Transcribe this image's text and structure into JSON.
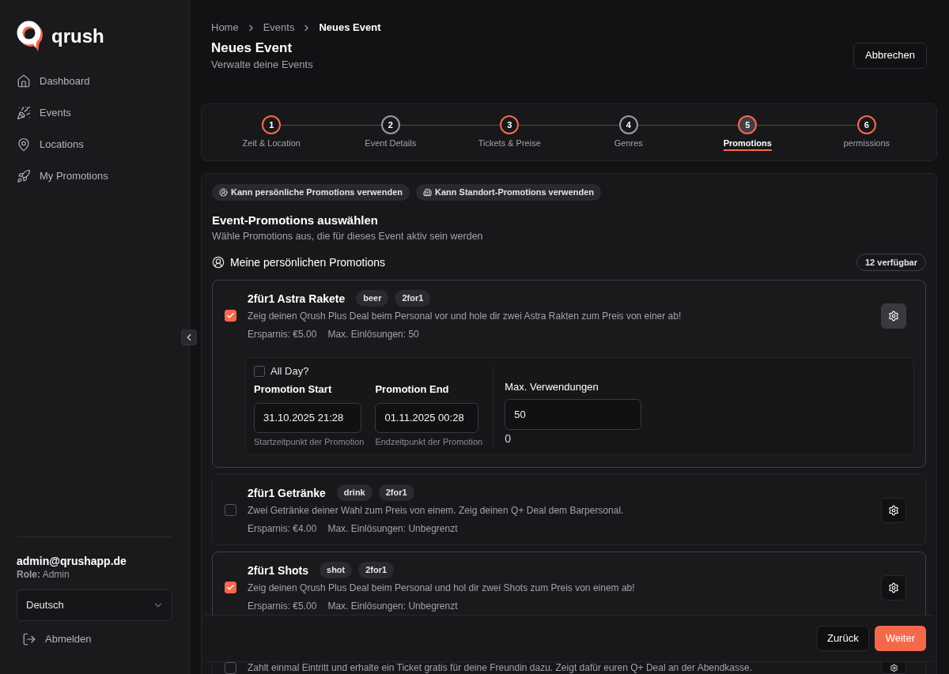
{
  "sidebar": {
    "logo": "qrush",
    "nav": [
      {
        "label": "Dashboard"
      },
      {
        "label": "Events"
      },
      {
        "label": "Locations"
      },
      {
        "label": "My Promotions"
      }
    ],
    "user": {
      "email": "admin@qrushapp.de",
      "role": "**Role:** Admin"
    },
    "language": "Deutsch",
    "logout": "Abmelden"
  },
  "breadcrumb": [
    {
      "label": "Home",
      "current": false
    },
    {
      "label": "Events",
      "current": false
    },
    {
      "label": "Neues Event",
      "current": true
    }
  ],
  "header": {
    "title": "Neues Event",
    "subtitle": "Verwalte deine Events",
    "cancel_button": "Abbrechen"
  },
  "stepper": {
    "steps": [
      {
        "number": "1",
        "label": "Zeit & Location",
        "complete": true,
        "selected": false
      },
      {
        "number": "2",
        "label": "Event Details",
        "complete": false,
        "selected": false
      },
      {
        "number": "3",
        "label": "Tickets & Preise",
        "complete": true,
        "selected": false
      },
      {
        "number": "4",
        "label": "Genres",
        "complete": false,
        "selected": false
      },
      {
        "number": "5",
        "label": "Promotions",
        "complete": true,
        "selected": true
      },
      {
        "number": "6",
        "label": "permissions",
        "complete": true,
        "selected": false
      }
    ]
  },
  "promotions": {
    "badges": [
      "Kann persönliche Promotions verwenden",
      "Kann Standort-Promotions verwenden"
    ],
    "title": "Event-Promotions auswählen",
    "subtitle": "Wähle Promotions aus, die für dieses Event aktiv sein werden",
    "section": {
      "title": "Meine persönlichen Promotions",
      "count": "12 verfügbar"
    },
    "items": [
      {
        "title": "2für1 Astra Rakete",
        "tags": [
          "beer",
          "2for1"
        ],
        "description": "Zeig deinen Qrush Plus Deal beim Personal vor und hole dir zwei Astra Rakten zum Preis von einer ab!",
        "savings": "Ersparnis: €5.00",
        "max": "Max. Einlösungen: 50",
        "checked": true,
        "expanded": true,
        "settings": {
          "all_day": {
            "label": "All Day?",
            "checked": false
          },
          "start": {
            "label": "Promotion Start",
            "value": "31.10.2025 21:28",
            "hint": "Startzeitpunkt der Promotion"
          },
          "end": {
            "label": "Promotion End",
            "value": "01.11.2025 00:28",
            "hint": "Endzeitpunkt der Promotion"
          },
          "max_uses": {
            "label": "Max. Verwendungen",
            "value": "50",
            "note": "0"
          }
        }
      },
      {
        "title": "2für1 Getränke",
        "tags": [
          "drink",
          "2for1"
        ],
        "description": "Zwei Getränke deiner Wahl zum Preis von einem. Zeig deinen Q+ Deal dem Barpersonal.",
        "savings": "Ersparnis: €4.00",
        "max": "Max. Einlösungen: Unbegrenzt",
        "checked": false,
        "expanded": false
      },
      {
        "title": "2für1 Shots",
        "tags": [
          "shot",
          "2for1"
        ],
        "description": "Zeig deinen Qrush Plus Deal beim Personal und hol dir zwei Shots zum Preis von einem ab!",
        "savings": "Ersparnis: €5.00",
        "max": "Max. Einlösungen: Unbegrenzt",
        "checked": true,
        "expanded": false
      },
      {
        "description": "Zahlt einmal Eintritt und erhalte ein Ticket gratis für deine Freundin dazu. Zeigt dafür euren Q+ Deal an der Abendkasse.",
        "checked": false,
        "expanded": false
      }
    ]
  },
  "footer": {
    "back_button": "Zurück",
    "next_button": "Weiter"
  }
}
